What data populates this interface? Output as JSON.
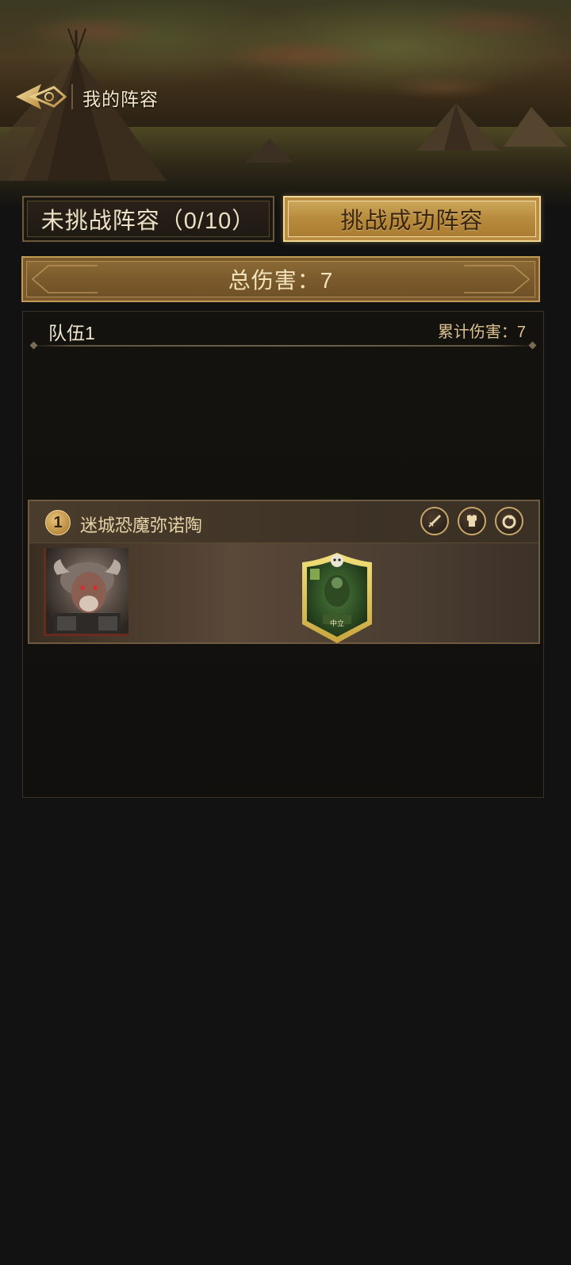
{
  "header": {
    "title": "我的阵容"
  },
  "tabs": [
    {
      "label": "未挑战阵容（0/10）",
      "active": false
    },
    {
      "label": "挑战成功阵容",
      "active": true
    }
  ],
  "total_damage": {
    "text": "总伤害：7"
  },
  "team": {
    "name": "队伍1",
    "damage_text": "累计伤害：7"
  },
  "boss": {
    "index": "1",
    "name": "迷城恐魔弥诺陶",
    "equipment_icons": [
      "sword-icon",
      "armor-icon",
      "ring-icon"
    ]
  },
  "hero_card": {
    "label": "中立"
  },
  "colors": {
    "gold": "#d2ad62",
    "gold_border": "#f3d894",
    "text_light": "#efe6d0",
    "text_gold": "#dcc390",
    "panel_bg": "#121212"
  }
}
